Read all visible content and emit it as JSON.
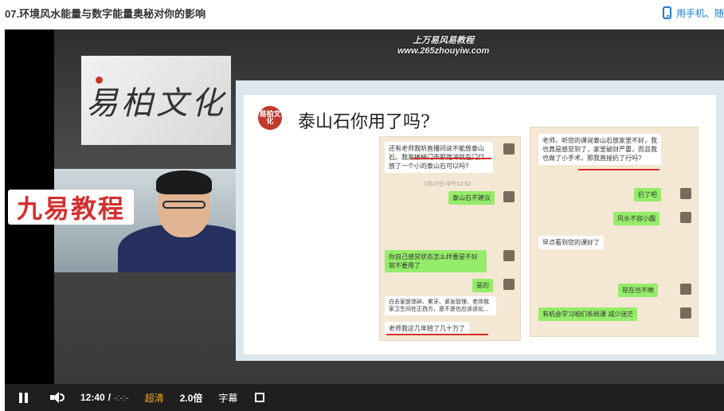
{
  "page": {
    "title": "07.环境风水能量与数字能量奥秘对你的影响",
    "mobile_link": "用手机、随"
  },
  "video": {
    "watermark_line1": "上万易风易教程",
    "watermark_line2": "www.265zhouyiw.com",
    "logo_text": "易柏文化",
    "course_label": "九易教程",
    "slide": {
      "badge": "易柏文化",
      "heading": "泰山石你用了吗?",
      "chat_left": {
        "msg1": "还有老师我听直播间说不能放泰山石。我家楼梯门市那路冲就在门口放了一个小的泰山石可以吗?",
        "time": "1月27日 中午12:52",
        "reply1": "泰山石不建议",
        "msg2": "你自己感觉状态怎么样要是不好就不要用了",
        "reply2": "是的",
        "msg3": "白去家是琐碎、累牙、紧张管理、老师我家卫生间在正西方，是不是也应该该化...",
        "msg4": "老师我这几年赔了几十万了"
      },
      "chat_right": {
        "msg1": "老师、听您的课说泰山石放家里不好，我也真是感觉到了，家里破财严重，而且我也做了小手术，那我直接扔了行吗?",
        "reply1": "扔了吧",
        "reply2": "风水不容小觑",
        "msg2": "早点看到您的课好了",
        "reply3": "现在也不晚",
        "reply4": "有机会学习咱们系统课 减少迷茫"
      }
    }
  },
  "controls": {
    "current_time": "12:40",
    "separator": "/",
    "total_time": "-:-:-",
    "quality": "超清",
    "speed": "2.0倍",
    "subtitles": "字幕"
  },
  "colors": {
    "accent_blue": "#1d7bd6",
    "quality_orange": "#f5a623",
    "course_red": "#d32f2f"
  }
}
